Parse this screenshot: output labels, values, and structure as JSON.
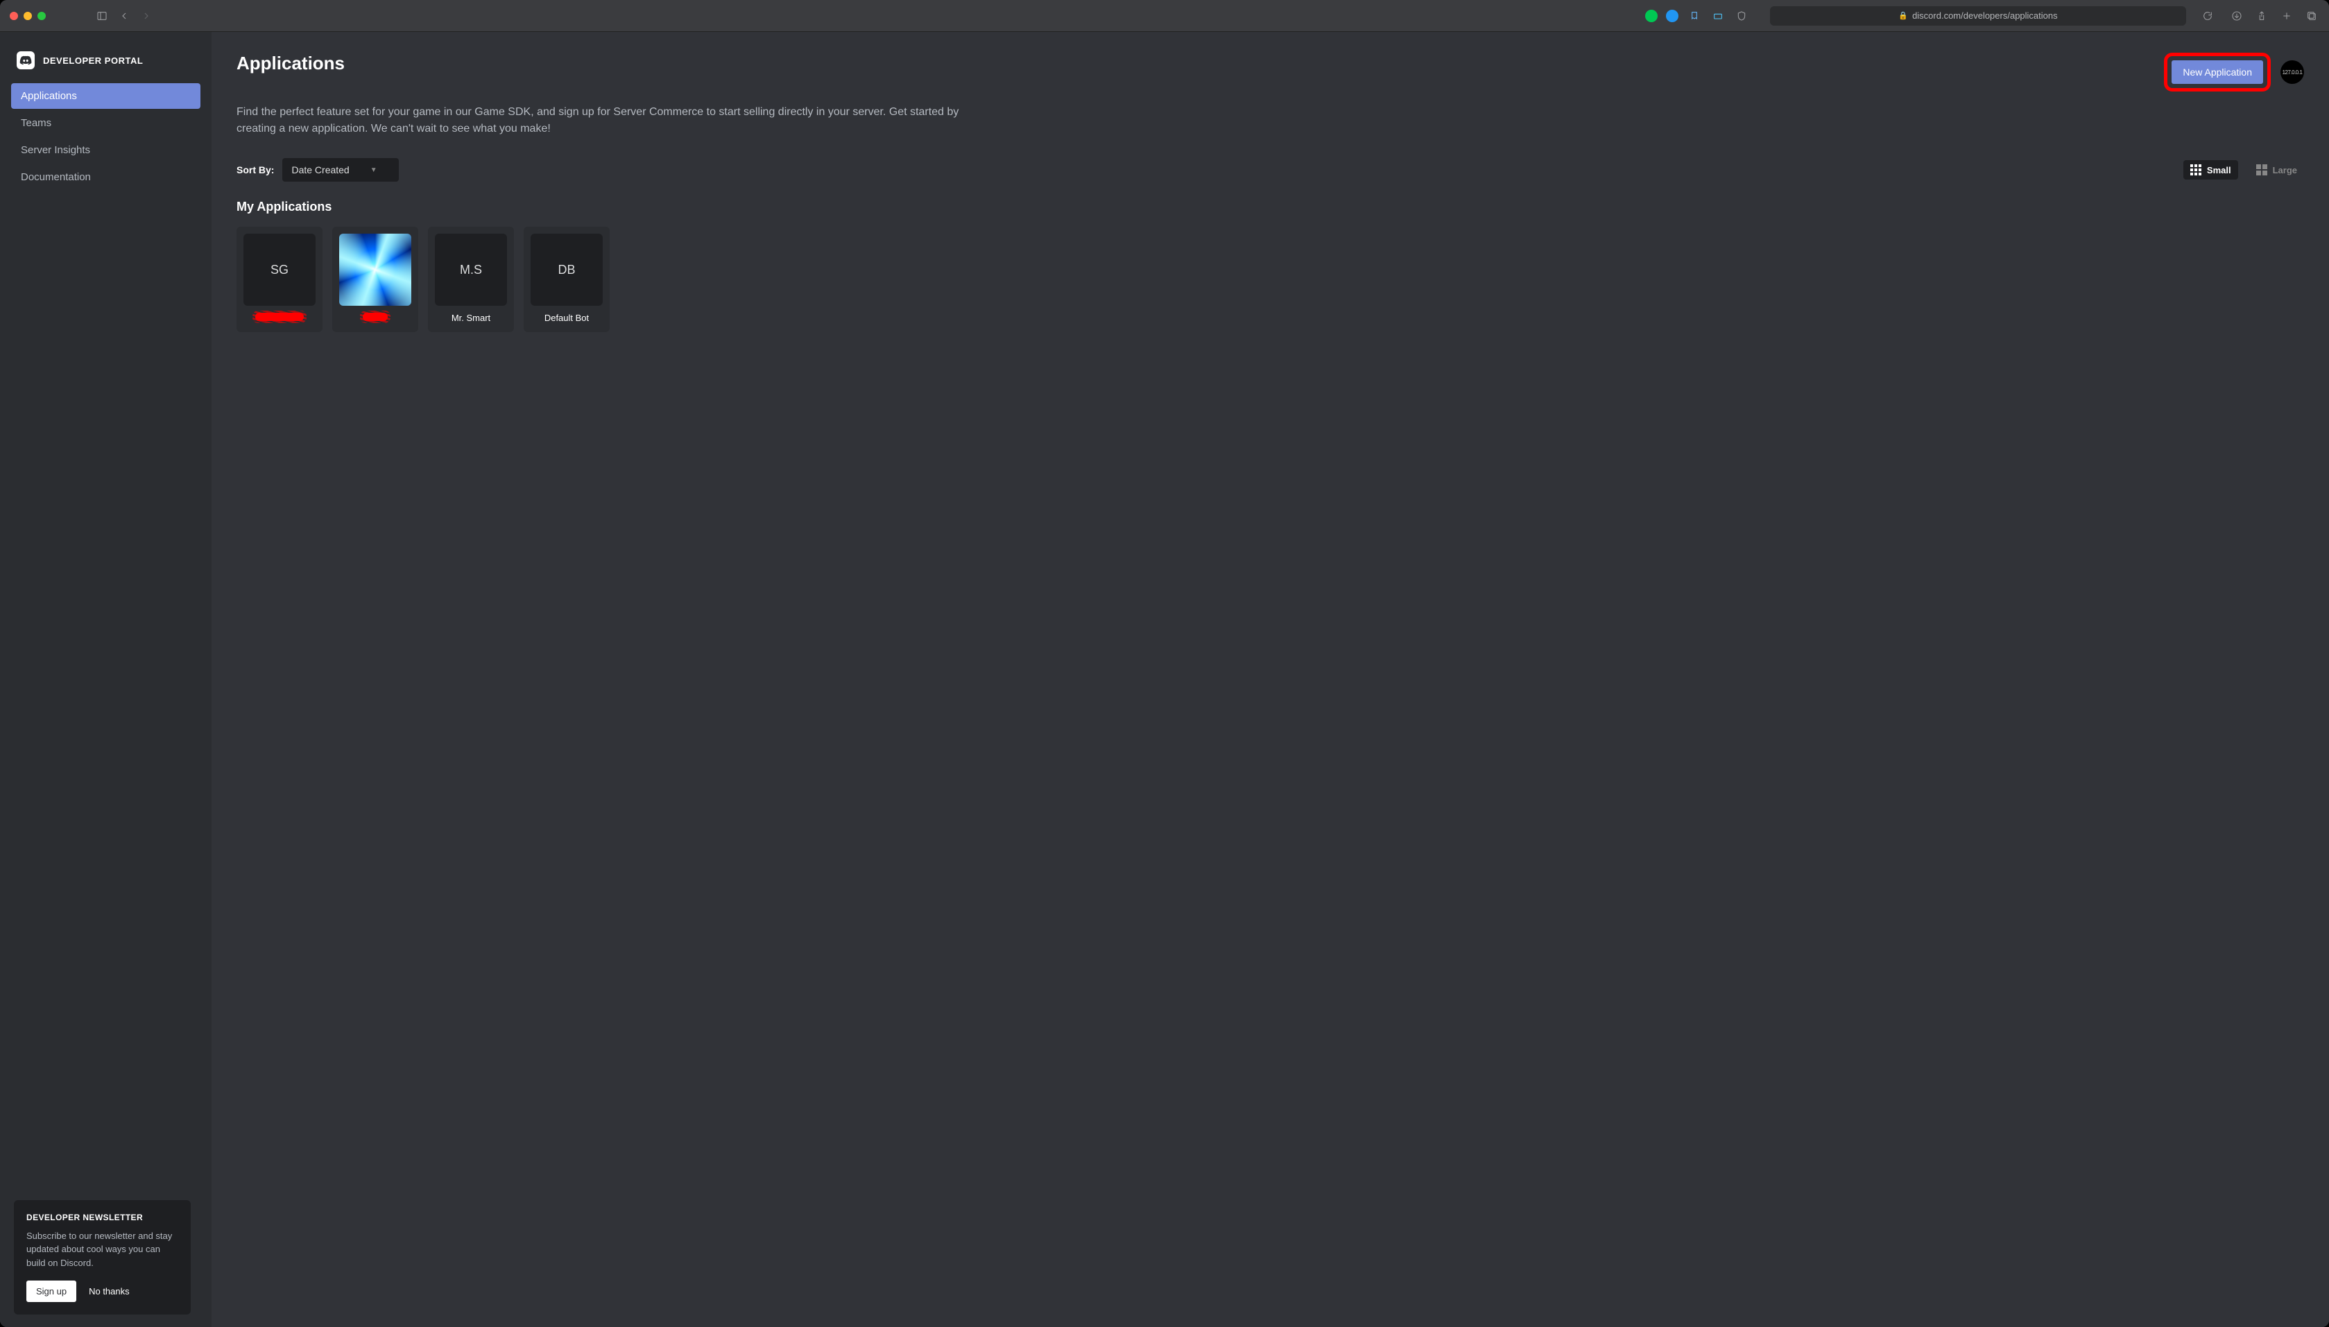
{
  "browser": {
    "url": "discord.com/developers/applications"
  },
  "sidebar": {
    "brand": "DEVELOPER PORTAL",
    "items": [
      {
        "label": "Applications",
        "active": true
      },
      {
        "label": "Teams",
        "active": false
      },
      {
        "label": "Server Insights",
        "active": false
      },
      {
        "label": "Documentation",
        "active": false
      }
    ]
  },
  "newsletter": {
    "title": "DEVELOPER NEWSLETTER",
    "body": "Subscribe to our newsletter and stay updated about cool ways you can build on Discord.",
    "signup": "Sign up",
    "nothanks": "No thanks"
  },
  "header": {
    "title": "Applications",
    "new_app": "New Application",
    "avatar_text": "127.0.0.1"
  },
  "description": "Find the perfect feature set for your game in our Game SDK, and sign up for Server Commerce to start selling directly in your server. Get started by creating a new application. We can't wait to see what you make!",
  "sort": {
    "label": "Sort By:",
    "value": "Date Created"
  },
  "view": {
    "small": "Small",
    "large": "Large"
  },
  "apps": {
    "section_title": "My Applications",
    "items": [
      {
        "initials": "SG",
        "name": "",
        "redacted": true,
        "thumb": "text"
      },
      {
        "initials": "",
        "name": "",
        "redacted": true,
        "redacted_short": true,
        "thumb": "image"
      },
      {
        "initials": "M.S",
        "name": "Mr. Smart",
        "redacted": false,
        "thumb": "text"
      },
      {
        "initials": "DB",
        "name": "Default Bot",
        "redacted": false,
        "thumb": "text"
      }
    ]
  }
}
